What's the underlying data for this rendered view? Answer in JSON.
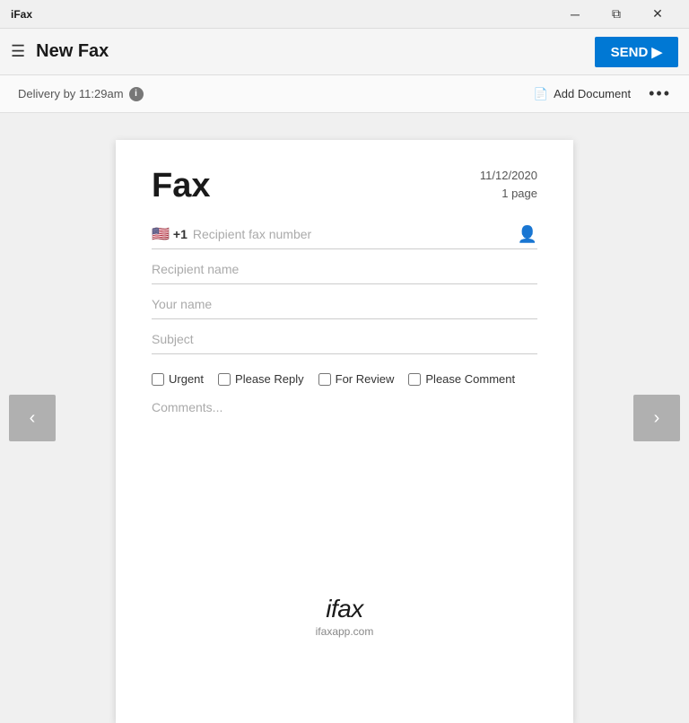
{
  "app": {
    "title": "iFax"
  },
  "titlebar": {
    "minimize_label": "─",
    "restore_label": "⧉",
    "close_label": "✕"
  },
  "header": {
    "hamburger_label": "☰",
    "title": "New Fax",
    "send_label": "SEND ▶"
  },
  "toolbar": {
    "delivery_text": "Delivery by 11:29am",
    "info_label": "i",
    "add_document_label": "Add Document",
    "more_label": "•••"
  },
  "nav": {
    "prev_label": "‹",
    "next_label": "›"
  },
  "fax": {
    "title": "Fax",
    "date": "11/12/2020",
    "pages": "1 page",
    "flag_emoji": "🇺🇸",
    "prefix": "+1",
    "recipient_fax_placeholder": "Recipient fax number",
    "recipient_name_placeholder": "Recipient name",
    "your_name_placeholder": "Your name",
    "subject_placeholder": "Subject",
    "checkboxes": [
      {
        "id": "urgent",
        "label": "Urgent"
      },
      {
        "id": "please-reply",
        "label": "Please Reply"
      },
      {
        "id": "for-review",
        "label": "For Review"
      },
      {
        "id": "please-comment",
        "label": "Please Comment"
      }
    ],
    "comments_placeholder": "Comments...",
    "brand_italic": "i",
    "brand_text": "fax",
    "brand_url": "ifaxapp.com"
  }
}
